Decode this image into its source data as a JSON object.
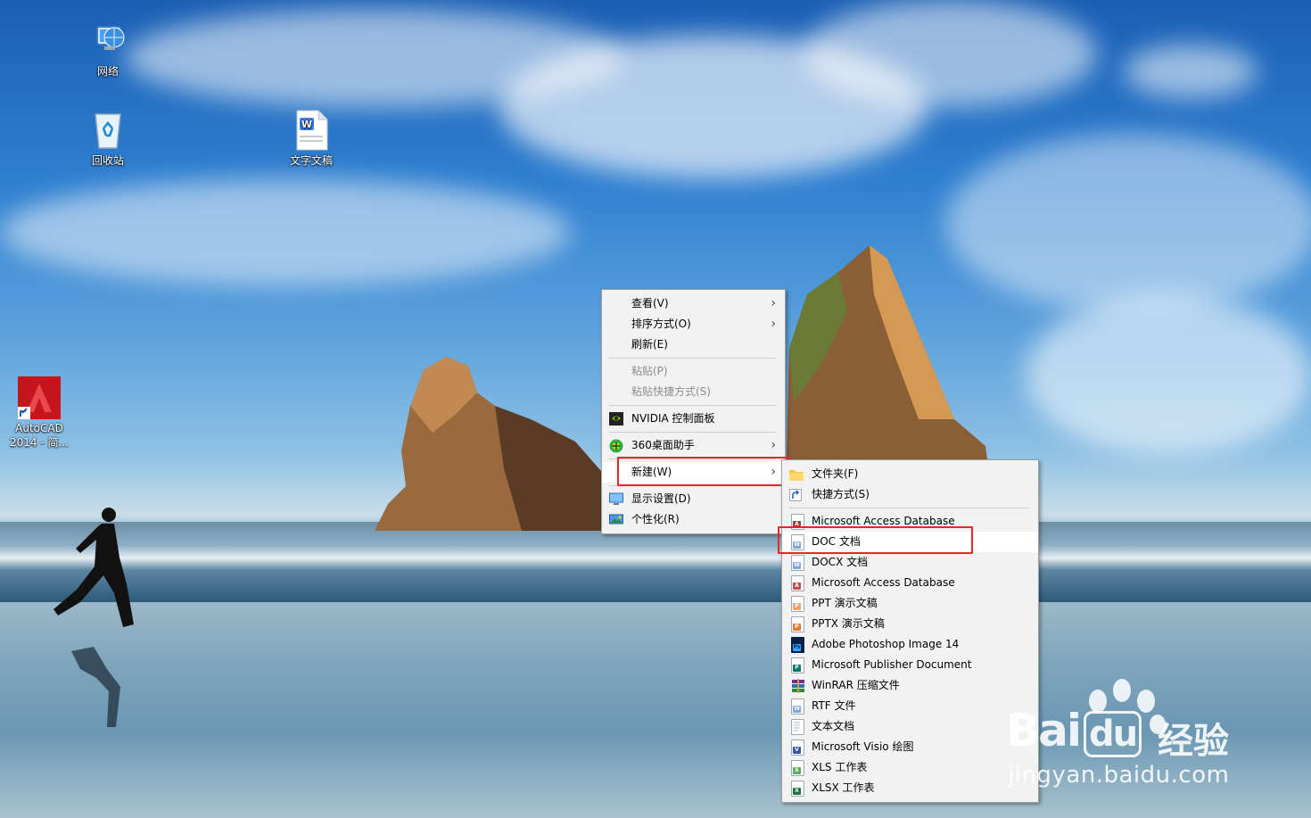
{
  "desktop": {
    "icons": [
      {
        "label": "网络",
        "icon": "network-icon"
      },
      {
        "label": "回收站",
        "icon": "recycle-bin-icon"
      },
      {
        "label": "文字文稿",
        "icon": "wps-document-icon"
      },
      {
        "label_line1": "AutoCAD",
        "label_line2": "2014 - 简...",
        "icon": "autocad-icon"
      }
    ]
  },
  "context_menu": {
    "items": [
      {
        "label": "查看(V)",
        "submenu": true
      },
      {
        "label": "排序方式(O)",
        "submenu": true
      },
      {
        "label": "刷新(E)"
      },
      {
        "label": "粘贴(P)",
        "disabled": true
      },
      {
        "label": "粘贴快捷方式(S)",
        "disabled": true
      },
      {
        "label": "NVIDIA 控制面板",
        "icon": "nvidia-icon"
      },
      {
        "label": "360桌面助手",
        "icon": "360-icon",
        "submenu": true
      },
      {
        "label": "新建(W)",
        "submenu": true,
        "highlighted": true
      },
      {
        "label": "显示设置(D)",
        "icon": "display-icon"
      },
      {
        "label": "个性化(R)",
        "icon": "personalize-icon"
      }
    ]
  },
  "new_submenu": {
    "items": [
      {
        "label": "文件夹(F)",
        "icon": "folder-icon"
      },
      {
        "label": "快捷方式(S)",
        "icon": "shortcut-icon"
      },
      {
        "label": "Microsoft Access Database",
        "icon": "access-icon"
      },
      {
        "label": "DOC 文档",
        "icon": "doc-icon",
        "highlighted": true
      },
      {
        "label": "DOCX 文档",
        "icon": "docx-icon"
      },
      {
        "label": "Microsoft Access Database",
        "icon": "access-icon"
      },
      {
        "label": "PPT 演示文稿",
        "icon": "ppt-icon"
      },
      {
        "label": "PPTX 演示文稿",
        "icon": "pptx-icon"
      },
      {
        "label": "Adobe Photoshop Image 14",
        "icon": "photoshop-icon"
      },
      {
        "label": "Microsoft Publisher Document",
        "icon": "publisher-icon"
      },
      {
        "label": "WinRAR 压缩文件",
        "icon": "winrar-icon"
      },
      {
        "label": "RTF 文件",
        "icon": "rtf-icon"
      },
      {
        "label": "文本文档",
        "icon": "text-document-icon"
      },
      {
        "label": "Microsoft Visio 绘图",
        "icon": "visio-icon"
      },
      {
        "label": "XLS 工作表",
        "icon": "xls-icon"
      },
      {
        "label": "XLSX 工作表",
        "icon": "xlsx-icon"
      }
    ]
  },
  "watermark": {
    "brand": "Bai",
    "brand_du": "du",
    "brand_suffix": "经验",
    "url": "jingyan.baidu.com"
  },
  "colors": {
    "highlight_box": "#e8262b",
    "menu_bg": "#f2f2f2",
    "disabled_text": "#8d8d8d"
  }
}
